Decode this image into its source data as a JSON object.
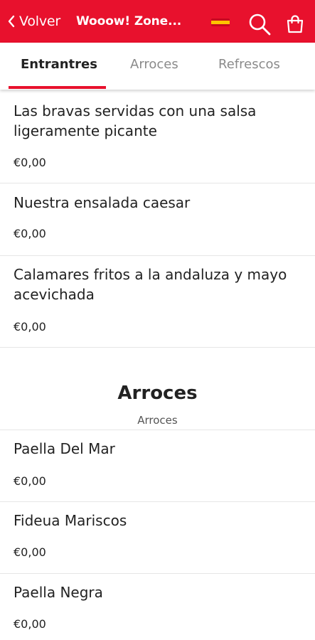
{
  "header": {
    "back_label": "Volver",
    "title": "Wooow! Zone...",
    "language_flag": "spain-flag-icon",
    "search_icon": "search-icon",
    "bag_icon": "shopping-bag-icon",
    "accent_color": "#e8112d"
  },
  "tabs": [
    {
      "label": "Entrantres",
      "active": true
    },
    {
      "label": "Arroces",
      "active": false
    },
    {
      "label": "Refrescos",
      "active": false
    }
  ],
  "sections": {
    "entrantes": {
      "items": [
        {
          "name": "Las bravas servidas con una salsa ligeramente picante",
          "price": "€0,00"
        },
        {
          "name": "Nuestra ensalada caesar",
          "price": "€0,00"
        },
        {
          "name": "Calamares fritos a la andaluza y mayo acevichada",
          "price": "€0,00"
        }
      ]
    },
    "arroces": {
      "title": "Arroces",
      "subtitle": "Arroces",
      "items": [
        {
          "name": "Paella Del Mar",
          "price": "€0,00"
        },
        {
          "name": "Fideua Mariscos",
          "price": "€0,00"
        },
        {
          "name": "Paella Negra",
          "price": "€0,00"
        }
      ]
    }
  }
}
